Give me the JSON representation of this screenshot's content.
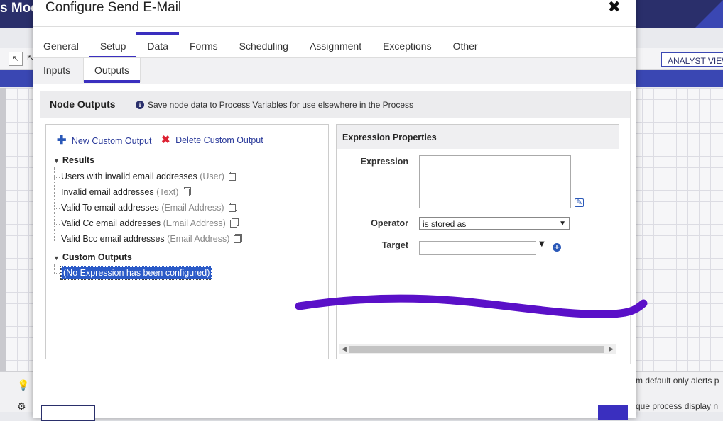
{
  "background": {
    "app_title": "s Moc",
    "analyst_view_label": "ANALYST VIEW",
    "bottom_text_1": "m default only alerts p",
    "bottom_text_2": "que process display n",
    "tool_pointer": "↖",
    "tool_other": "⇱"
  },
  "dialog": {
    "title": "Configure Send E-Mail",
    "close_glyph": "✖",
    "tabs": [
      "General",
      "Setup",
      "Data",
      "Forms",
      "Scheduling",
      "Assignment",
      "Exceptions",
      "Other"
    ],
    "active_tab": "Data",
    "subtabs": [
      "Inputs",
      "Outputs"
    ],
    "active_subtab": "Outputs"
  },
  "node_outputs": {
    "title": "Node Outputs",
    "info_text": "Save node data to Process Variables for use elsewhere in the Process",
    "new_custom_output": "New Custom Output",
    "delete_custom_output": "Delete Custom Output",
    "results_label": "Results",
    "results": [
      {
        "name": "Users with invalid email addresses",
        "type": "(User)"
      },
      {
        "name": "Invalid email addresses",
        "type": "(Text)"
      },
      {
        "name": "Valid To email addresses",
        "type": "(Email Address)"
      },
      {
        "name": "Valid Cc email addresses",
        "type": "(Email Address)"
      },
      {
        "name": "Valid Bcc email addresses",
        "type": "(Email Address)"
      }
    ],
    "custom_outputs_label": "Custom Outputs",
    "custom_outputs": [
      "(No Expression has been configured)"
    ]
  },
  "expression_properties": {
    "title": "Expression Properties",
    "expression_label": "Expression",
    "expression_value": "",
    "operator_label": "Operator",
    "operator_value": "is stored as",
    "target_label": "Target",
    "target_value": ""
  },
  "colors": {
    "accent": "#3a2fbf",
    "header": "#2a2f6b",
    "scribble": "#5a10c8",
    "selection": "#2b5ac7"
  }
}
